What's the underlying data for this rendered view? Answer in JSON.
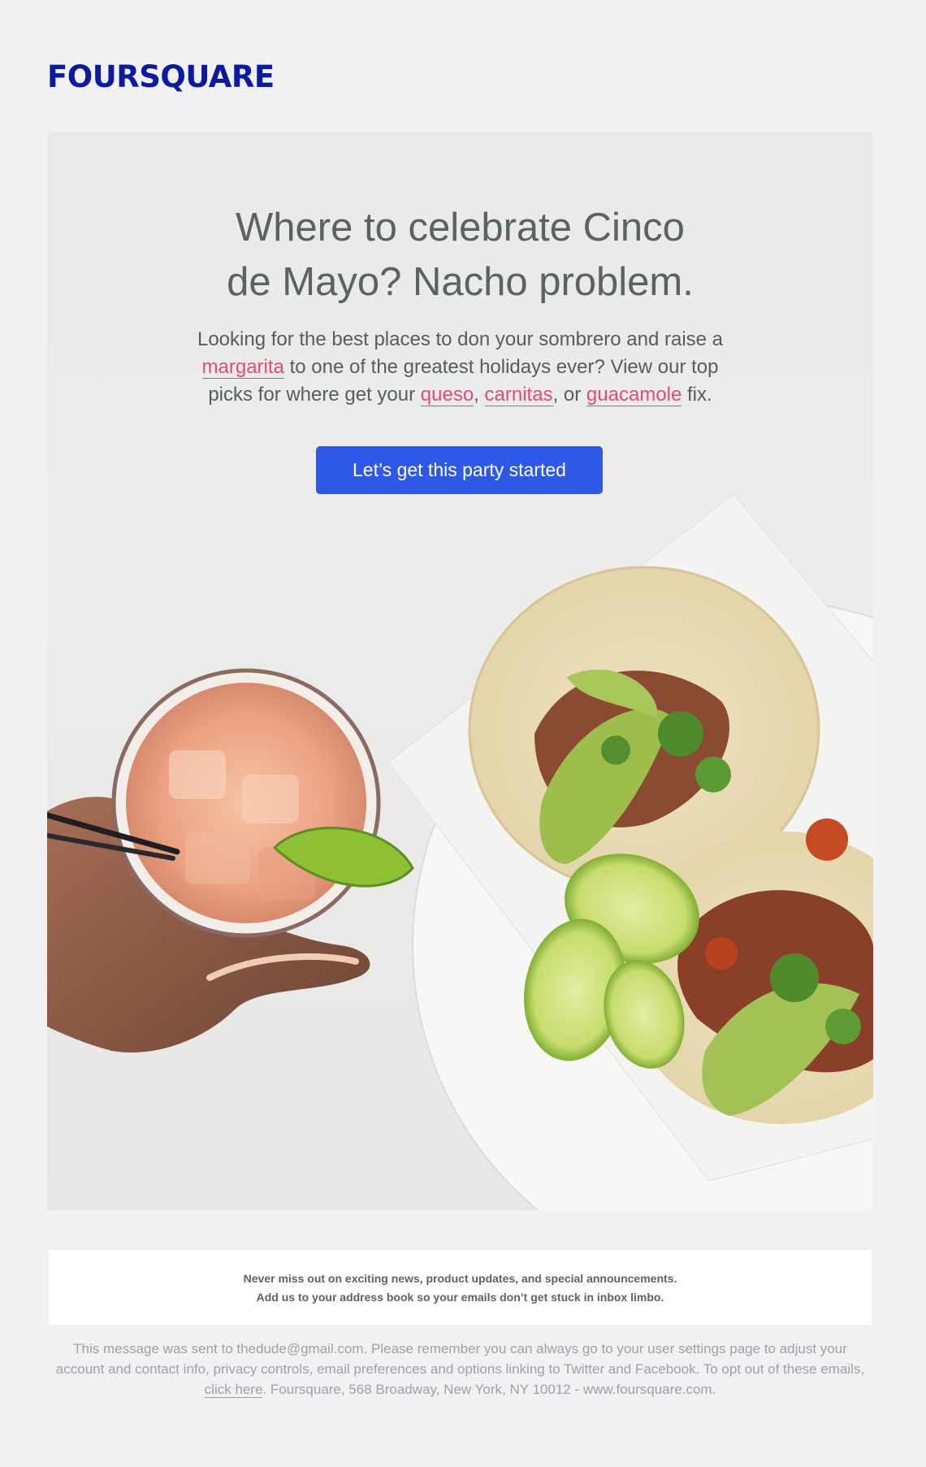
{
  "brand": {
    "logo_text": "FOURSQUARE",
    "logo_color": "#0e1a9c"
  },
  "hero": {
    "headline": "Where to celebrate Cinco de Mayo? Nacho problem.",
    "body": {
      "part1": "Looking for the best places to don your sombrero and raise a ",
      "link_margarita": "margarita",
      "part2": " to one of the greatest holidays ever? View our top picks for where get your ",
      "link_queso": "queso",
      "sep1": ", ",
      "link_carnitas": "carnitas",
      "sep2": ", or ",
      "link_guacamole": "guacamole",
      "part3": " fix."
    },
    "cta_label": "Let’s get this party started",
    "cta_color": "#2d58e8",
    "link_color": "#e54a78"
  },
  "notice": {
    "line1": "Never miss out on exciting news, product updates, and special announcements.",
    "line2": "Add us to your address book so your emails don’t get stuck in inbox limbo."
  },
  "footer": {
    "text1": "This message was sent to thedude@gmail.com. Please remember you can always go to your user settings page to adjust your account and contact info, privacy controls, email preferences and options linking to Twitter and Facebook. To opt out of these emails, ",
    "link_click_here": "click here",
    "text2": ". Foursquare, 568 Broadway, New York, NY 10012 - www.foursquare.com."
  }
}
